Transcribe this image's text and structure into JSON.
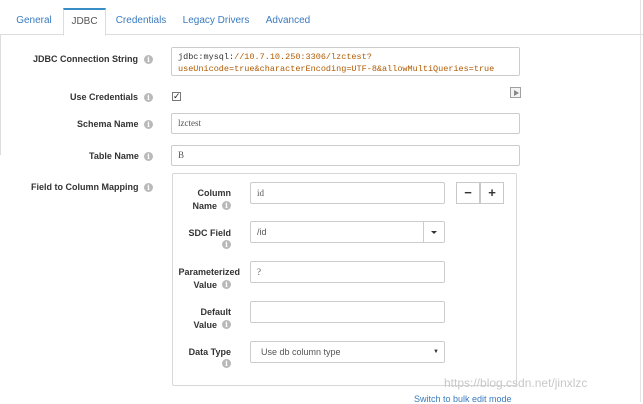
{
  "tabs": [
    {
      "label": "General"
    },
    {
      "label": "JDBC"
    },
    {
      "label": "Credentials"
    },
    {
      "label": "Legacy Drivers"
    },
    {
      "label": "Advanced"
    }
  ],
  "active_tab": "JDBC",
  "form": {
    "connection_string": {
      "label": "JDBC Connection String",
      "value_prefix": "jdbc:mysql:",
      "value_host": "//10.7.10.250:3306/lzctest?",
      "value_line2": "useUnicode=true&characterEncoding=UTF-8&allowMultiQueries=true"
    },
    "use_credentials": {
      "label": "Use Credentials",
      "checked": true
    },
    "schema_name": {
      "label": "Schema Name",
      "value": "lzctest"
    },
    "table_name": {
      "label": "Table Name",
      "value": "B"
    },
    "field_mapping": {
      "label": "Field to Column Mapping",
      "column_name_line1": "Column",
      "column_name_line2": "Name",
      "column_name_value": "id",
      "sdc_field_label": "SDC Field",
      "sdc_field_value": "/id",
      "param_line1": "Parameterized",
      "param_line2": "Value",
      "param_value": "?",
      "default_line1": "Default",
      "default_line2": "Value",
      "default_value": "",
      "data_type_label": "Data Type",
      "data_type_value": "Use db column type",
      "remove_label": "−",
      "add_label": "+"
    }
  },
  "bulk_edit_link": "Switch to bulk edit mode",
  "watermark": "https://blog.csdn.net/jinxlzc",
  "colors": {
    "link": "#3a7bbf",
    "active_tab_border": "#3a8ec8"
  }
}
